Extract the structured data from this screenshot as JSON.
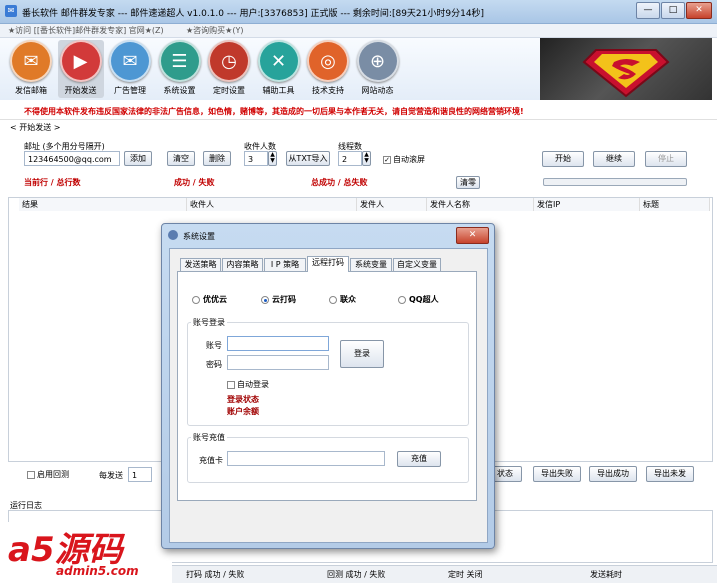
{
  "window": {
    "title": "番长软件 邮件群发专家 --- 邮件速递超人 v1.0.1.0 --- 用户:[3376853] 正式版 --- 剩余时间:[89天21小时9分14秒]",
    "min": "—",
    "max": "□",
    "close": "✕"
  },
  "menu": [
    "★访问 [[番长软件]邮件群发专家] 官网★(Z)",
    "★咨询购买★(Y)"
  ],
  "toolbar": [
    {
      "label": "发信邮箱",
      "icon": "mailbox-icon",
      "color": "#e07a28",
      "glyph": "✉"
    },
    {
      "label": "开始发送",
      "icon": "play-icon",
      "color": "#d23a3a",
      "glyph": "▶"
    },
    {
      "label": "广告管理",
      "icon": "envelope-icon",
      "color": "#4d97d3",
      "glyph": "✉"
    },
    {
      "label": "系统设置",
      "icon": "sliders-icon",
      "color": "#2f9c8c",
      "glyph": "☰"
    },
    {
      "label": "定时设置",
      "icon": "clock-icon",
      "color": "#c0392b",
      "glyph": "◷"
    },
    {
      "label": "辅助工具",
      "icon": "wrench-icon",
      "color": "#27a39b",
      "glyph": "✕"
    },
    {
      "label": "技术支持",
      "icon": "lifebuoy-icon",
      "color": "#e0632a",
      "glyph": "◎"
    },
    {
      "label": "网站动态",
      "icon": "globe-icon",
      "color": "#7a8da5",
      "glyph": "⊕"
    }
  ],
  "warning": "不得使用本软件发布违反国家法律的非法广告信息，如色情，赌博等，其造成的一切后果与本作者无关，请自觉营造和谐良性的网络营销环境!",
  "group_label": "< 开始发送 >",
  "form": {
    "email_label": "邮址 (多个用分号隔开)",
    "email_value": "123464500@qq.com",
    "add": "添加",
    "clear": "清空",
    "delete": "删除",
    "recipients_label": "收件人数",
    "recipients_value": "3",
    "import_txt": "从TXT导入",
    "threads_label": "线程数",
    "threads_value": "2",
    "auto_scroll": "自动滚屏",
    "start": "开始",
    "continue": "继续",
    "stop": "停止",
    "current_total": "当前行 / 总行数",
    "success_fail": "成功 / 失败",
    "total_success_fail": "总成功 / 总失败",
    "reset": "清零"
  },
  "table_headers": [
    "结果",
    "收件人",
    "发件人",
    "发件人名称",
    "发信IP",
    "标题"
  ],
  "bottom": {
    "enable_reply": "启用回测",
    "per_send_label": "每发送",
    "per_send_value": "1",
    "status_btn": "状态",
    "export_fail": "导出失败",
    "export_success": "导出成功",
    "export_unsent": "导出未发",
    "log_label": "运行日志"
  },
  "statusbar": [
    "打码 成功 / 失败",
    "回测 成功 / 失败",
    "定时 关闭",
    "发送耗时"
  ],
  "dialog": {
    "title": "系统设置",
    "close": "✕",
    "tabs": [
      "发送策略",
      "内容策略",
      "I P 策略",
      "远程打码",
      "系统变量",
      "自定义变量"
    ],
    "active_tab": 3,
    "options": [
      "优优云",
      "云打码",
      "联众",
      "QQ超人"
    ],
    "selected_option": 1,
    "login_group": "账号登录",
    "account_label": "账号",
    "password_label": "密码",
    "login_btn": "登录",
    "auto_login": "自动登录",
    "login_status": "登录状态",
    "balance": "账户余额",
    "recharge_group": "账号充值",
    "card_label": "充值卡",
    "recharge_btn": "充值"
  },
  "watermark": {
    "main": "a5源码",
    "sub": "admin5.com"
  }
}
